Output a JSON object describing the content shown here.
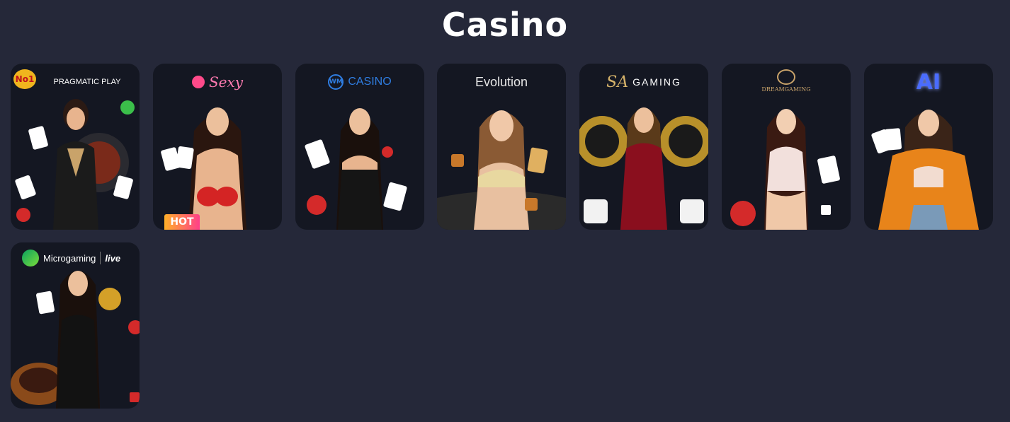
{
  "page": {
    "title": "Casino"
  },
  "providers": [
    {
      "logo_text": "PRAGMATIC PLAY",
      "badge": "No1",
      "icon": "pragmatic-play-logo"
    },
    {
      "logo_text": "Sexy",
      "badge": "HOT",
      "icon": "sexy-logo"
    },
    {
      "logo_text": "CASINO",
      "badge": "WM",
      "icon": "wm-casino-logo"
    },
    {
      "logo_text": "Evolution",
      "icon": "evolution-logo"
    },
    {
      "logo_text": "GAMING",
      "badge": "SA",
      "icon": "sa-gaming-logo"
    },
    {
      "logo_text": "DREAMGAMING",
      "icon": "dream-gaming-logo"
    },
    {
      "logo_text": "AI",
      "icon": "ai-logo"
    },
    {
      "logo_text": "Microgaming",
      "badge": "live",
      "icon": "microgaming-logo"
    }
  ],
  "colors": {
    "background": "#252839",
    "card": "#141722",
    "hot_badge": "#ff6a3d",
    "wm_blue": "#2f7de1",
    "ai_blue": "#4a6cff"
  }
}
